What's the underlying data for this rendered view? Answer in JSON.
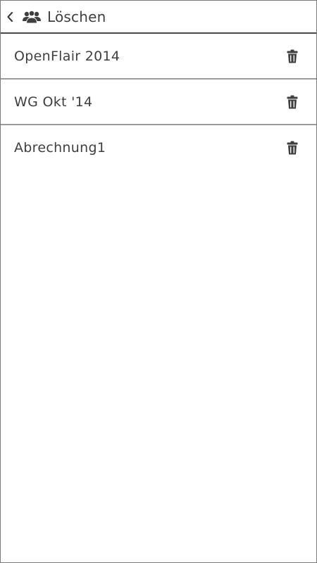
{
  "header": {
    "back_icon": "chevron-left-icon",
    "group_icon": "group-icon",
    "title": "Löschen"
  },
  "groups": [
    {
      "label": "OpenFlair 2014",
      "delete_icon": "trash-icon"
    },
    {
      "label": "WG Okt '14",
      "delete_icon": "trash-icon"
    },
    {
      "label": "Abrechnung1",
      "delete_icon": "trash-icon"
    }
  ],
  "colors": {
    "text": "#3f3f3f",
    "header_border": "#4a4a4a",
    "row_border": "#9a9a9a",
    "background": "#ffffff"
  }
}
